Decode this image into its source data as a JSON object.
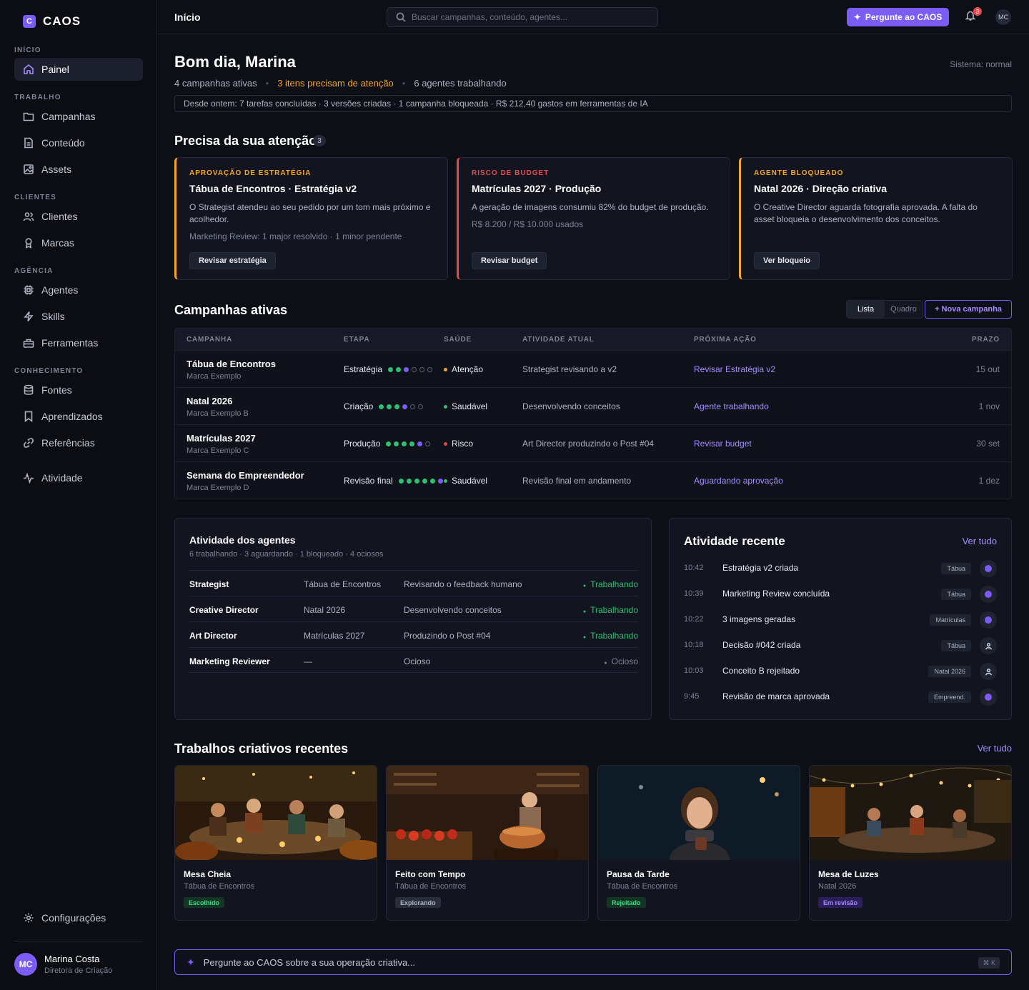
{
  "brand": {
    "logo_letter": "C",
    "name": "CAOS"
  },
  "nav": {
    "sections": [
      "INÍCIO",
      "TRABALHO",
      "CLIENTES",
      "AGÊNCIA",
      "CONHECIMENTO"
    ],
    "items": [
      "Painel",
      "Campanhas",
      "Conteúdo",
      "Assets",
      "Clientes",
      "Marcas",
      "Agentes",
      "Skills",
      "Ferramentas",
      "Fontes",
      "Aprendizados",
      "Referências",
      "Atividade"
    ],
    "settings": "Configurações"
  },
  "user": {
    "initials": "MC",
    "name": "Marina Costa",
    "role": "Diretora de Criação"
  },
  "topbar": {
    "breadcrumb": "Início",
    "search_placeholder": "Buscar campanhas, conteúdo, agentes...",
    "ask_label": "Pergunte ao CAOS",
    "notif_count": "3",
    "avatar": "MC"
  },
  "hero": {
    "greeting": "Bom dia, Marina",
    "system": "Sistema: normal",
    "active": "4 campanhas ativas",
    "attention": "3 itens precisam de atenção",
    "agents": "6 agentes trabalhando",
    "since": "Desde ontem: 7 tarefas concluídas · 3 versões criadas · 1 campanha bloqueada · R$ 212,40 gastos em ferramentas de IA"
  },
  "attention": {
    "title": "Precisa da sua atenção",
    "count": "3",
    "cards": [
      {
        "tag": "APROVAÇÃO DE ESTRATÉGIA",
        "color": "#f5a524",
        "title": "Tábua de Encontros · Estratégia v2",
        "desc": "O Strategist atendeu ao seu pedido por um tom mais próximo e acolhedor.",
        "sub": "Marketing Review: 1 major resolvido · 1 minor pendente",
        "button": "Revisar estratégia"
      },
      {
        "tag": "RISCO DE BUDGET",
        "color": "#e5484d",
        "title": "Matrículas 2027 · Produção",
        "desc": "A geração de imagens consumiu 82% do budget de produção.",
        "sub": "R$ 8.200 / R$ 10.000 usados",
        "button": "Revisar budget"
      },
      {
        "tag": "AGENTE BLOQUEADO",
        "color": "#f5a524",
        "title": "Natal 2026 · Direção criativa",
        "desc": "O Creative Director aguarda fotografia aprovada. A falta do asset bloqueia o desenvolvimento dos conceitos.",
        "sub": "",
        "button": "Ver bloqueio"
      }
    ]
  },
  "campaigns": {
    "title": "Campanhas ativas",
    "view_list": "Lista",
    "view_board": "Quadro",
    "new": "+ Nova campanha",
    "headers": [
      "CAMPANHA",
      "ETAPA",
      "SAÚDE",
      "ATIVIDADE ATUAL",
      "PRÓXIMA AÇÃO",
      "PRAZO"
    ],
    "rows": [
      {
        "name": "Tábua de Encontros",
        "brand": "Marca Exemplo",
        "stage": "Estratégia",
        "dots": [
          "g",
          "g",
          "p",
          "e",
          "e",
          "e"
        ],
        "health": "Atenção",
        "health_color": "#f5a524",
        "activity": "Strategist revisando a v2",
        "next": "Revisar Estratégia v2",
        "due": "15 out"
      },
      {
        "name": "Natal 2026",
        "brand": "Marca Exemplo B",
        "stage": "Criação",
        "dots": [
          "g",
          "g",
          "g",
          "p",
          "e",
          "e"
        ],
        "health": "Saudável",
        "health_color": "#2fbf71",
        "activity": "Desenvolvendo conceitos",
        "next": "Agente trabalhando",
        "due": "1 nov"
      },
      {
        "name": "Matrículas 2027",
        "brand": "Marca Exemplo C",
        "stage": "Produção",
        "dots": [
          "g",
          "g",
          "g",
          "g",
          "p",
          "e"
        ],
        "health": "Risco",
        "health_color": "#e5484d",
        "activity": "Art Director produzindo o Post #04",
        "next": "Revisar budget",
        "due": "30 set"
      },
      {
        "name": "Semana do Empreendedor",
        "brand": "Marca Exemplo D",
        "stage": "Revisão final",
        "dots": [
          "g",
          "g",
          "g",
          "g",
          "g",
          "p"
        ],
        "health": "Saudável",
        "health_color": "#2fbf71",
        "activity": "Revisão final em andamento",
        "next": "Aguardando aprovação",
        "due": "1 dez"
      }
    ]
  },
  "agents": {
    "title": "Atividade dos agentes",
    "sub": "6 trabalhando · 3 aguardando · 1 bloqueado · 4 ociosos",
    "rows": [
      {
        "name": "Strategist",
        "campaign": "Tábua de Encontros",
        "task": "Revisando o feedback humano",
        "status": "Trabalhando",
        "active": true
      },
      {
        "name": "Creative Director",
        "campaign": "Natal 2026",
        "task": "Desenvolvendo conceitos",
        "status": "Trabalhando",
        "active": true
      },
      {
        "name": "Art Director",
        "campaign": "Matrículas 2027",
        "task": "Produzindo o Post #04",
        "status": "Trabalhando",
        "active": true
      },
      {
        "name": "Marketing Reviewer",
        "campaign": "—",
        "task": "Ocioso",
        "status": "Ocioso",
        "active": false
      }
    ]
  },
  "recent": {
    "title": "Atividade recente",
    "all": "Ver tudo",
    "rows": [
      {
        "time": "10:42",
        "text": "Estratégia v2 criada",
        "tag": "Tábua",
        "icon": "agent"
      },
      {
        "time": "10:39",
        "text": "Marketing Review concluída",
        "tag": "Tábua",
        "icon": "agent"
      },
      {
        "time": "10:22",
        "text": "3 imagens geradas",
        "tag": "Matrículas",
        "icon": "agent"
      },
      {
        "time": "10:18",
        "text": "Decisão #042 criada",
        "tag": "Tábua",
        "icon": "user"
      },
      {
        "time": "10:03",
        "text": "Conceito B rejeitado",
        "tag": "Natal 2026",
        "icon": "user"
      },
      {
        "time": "9:45",
        "text": "Revisão de marca aprovada",
        "tag": "Empreend.",
        "icon": "agent"
      }
    ]
  },
  "creative": {
    "title": "Trabalhos criativos recentes",
    "all": "Ver tudo",
    "cards": [
      {
        "name": "Mesa Cheia",
        "campaign": "Tábua de Encontros",
        "badge": "Escolhido",
        "badge_bg": "#123524",
        "badge_fg": "#3ddc84",
        "scene": "feast"
      },
      {
        "name": "Feito com Tempo",
        "campaign": "Tábua de Encontros",
        "badge": "Explorando",
        "badge_bg": "#2a2e3c",
        "badge_fg": "#aeb2c0",
        "scene": "kitchen"
      },
      {
        "name": "Pausa da Tarde",
        "campaign": "Tábua de Encontros",
        "badge": "Rejeitado",
        "badge_bg": "#123524",
        "badge_fg": "#3ddc84",
        "scene": "portrait"
      },
      {
        "name": "Mesa de Luzes",
        "campaign": "Natal 2026",
        "badge": "Em revisão",
        "badge_bg": "#2a1f5c",
        "badge_fg": "#a58cff",
        "scene": "lights"
      }
    ]
  },
  "askbar": {
    "placeholder": "Pergunte ao CAOS sobre a sua operação criativa...",
    "shortcut": "⌘ K"
  }
}
